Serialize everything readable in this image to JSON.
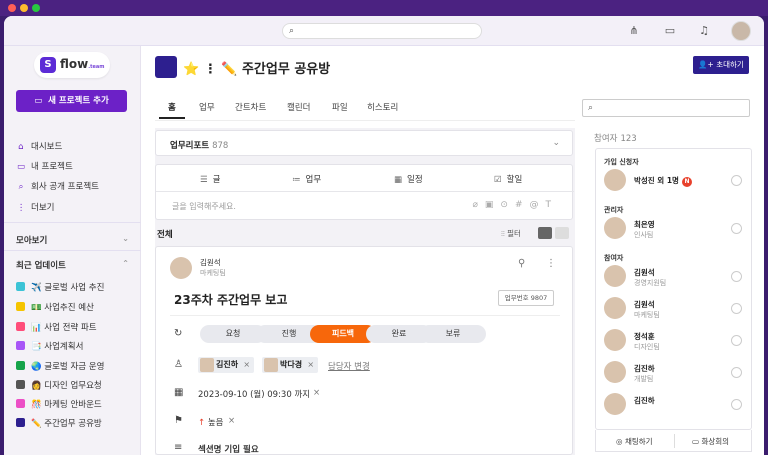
{
  "window": {
    "search_placeholder": ""
  },
  "brand": {
    "name": "flow",
    "suffix": ".team"
  },
  "sidebar": {
    "new_project_label": "새 프로젝트 추가",
    "nav": [
      {
        "label": "대시보드",
        "icon": "home-icon"
      },
      {
        "label": "내 프로젝트",
        "icon": "folder-icon"
      },
      {
        "label": "회사 공개 프로젝트",
        "icon": "search-icon"
      },
      {
        "label": "더보기",
        "icon": "more-vertical-icon"
      }
    ],
    "section_view": "모아보기",
    "section_recent": "최근 업데이트",
    "projects": [
      {
        "label": "✈️ 글로벌 사업 추진",
        "color": "#3cc3d6",
        "badge": true
      },
      {
        "label": "💵 사업추진 예산",
        "color": "#f5c400",
        "badge": true
      },
      {
        "label": "📊 사업 전략 파트",
        "color": "#ff4d7a",
        "badge": true
      },
      {
        "label": "📑 사업계획서",
        "color": "#a855f7",
        "badge": false
      },
      {
        "label": "🌏 글로벌 자금 운영",
        "color": "#16a34a",
        "badge": false
      },
      {
        "label": "👩 디자인 업무요청",
        "color": "#555555",
        "badge": false
      },
      {
        "label": "🎊 마케팅 안바운드",
        "color": "#ec4fc6",
        "badge": false
      },
      {
        "label": "✏️ 주간업무 공유방",
        "color": "#2d1f8f",
        "badge": false
      }
    ]
  },
  "project": {
    "title": "⭐ ⋮ ✏️ 주간업무 공유방",
    "invite_label": "초대하기",
    "tabs": [
      "홈",
      "업무",
      "간트차트",
      "캘린더",
      "파일",
      "히스토리"
    ],
    "active_tab": "홈"
  },
  "feed": {
    "report_label": "업무리포트",
    "report_count": "878",
    "compose_types": [
      {
        "label": "글",
        "icon": "doc-icon"
      },
      {
        "label": "업무",
        "icon": "list-icon"
      },
      {
        "label": "일정",
        "icon": "calendar-icon"
      },
      {
        "label": "할일",
        "icon": "checkbox-icon"
      }
    ],
    "compose_placeholder": "글을 입력해주세요.",
    "all_label": "전체",
    "filter_label": "필터",
    "post": {
      "author": "김원석",
      "team": "마케팅팀",
      "title": "23주차 주간업무 보고",
      "task_no": "업무번호 9807",
      "statuses": [
        "요청",
        "진행",
        "피드백",
        "완료",
        "보류"
      ],
      "active_status": "피드백",
      "assignees": [
        "김진하",
        "박다경"
      ],
      "change_assignee": "담당자 변경",
      "date": "2023-09-10 (월) 09:30 까지",
      "priority": "높음",
      "section_text": "섹션명 기입 필요"
    }
  },
  "participants": {
    "label": "참여자",
    "count": "123",
    "groups": [
      {
        "title": "가입 신청자",
        "items": [
          {
            "name": "박성진 외 1명",
            "team": "",
            "badge": "N"
          }
        ]
      },
      {
        "title": "관리자",
        "items": [
          {
            "name": "최은영",
            "team": "인사팀"
          }
        ]
      },
      {
        "title": "참여자",
        "items": [
          {
            "name": "김원석",
            "team": "경영지원팀"
          },
          {
            "name": "김원석",
            "team": "마케팅팀"
          },
          {
            "name": "정석훈",
            "team": "디자인팀"
          },
          {
            "name": "김진하",
            "team": "개발팀"
          },
          {
            "name": "김진하",
            "team": ""
          }
        ]
      }
    ],
    "chat_label": "채팅하기",
    "video_label": "화상회의"
  },
  "colors": {
    "brand_purple": "#6c21c7",
    "project_navy": "#2d1f8f",
    "feedback_orange": "#f7670b"
  }
}
